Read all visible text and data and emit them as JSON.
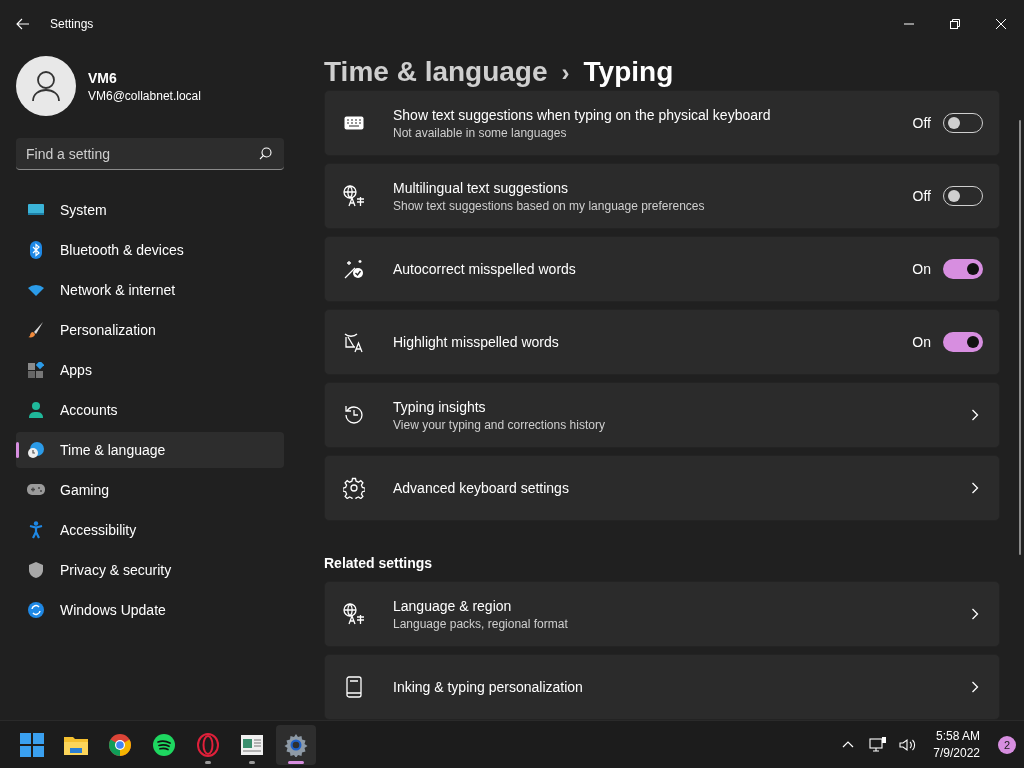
{
  "window": {
    "title": "Settings"
  },
  "user": {
    "name": "VM6",
    "email": "VM6@collabnet.local"
  },
  "search": {
    "placeholder": "Find a setting"
  },
  "sidebar": {
    "items": [
      {
        "label": "System",
        "selected": false
      },
      {
        "label": "Bluetooth & devices",
        "selected": false
      },
      {
        "label": "Network & internet",
        "selected": false
      },
      {
        "label": "Personalization",
        "selected": false
      },
      {
        "label": "Apps",
        "selected": false
      },
      {
        "label": "Accounts",
        "selected": false
      },
      {
        "label": "Time & language",
        "selected": true
      },
      {
        "label": "Gaming",
        "selected": false
      },
      {
        "label": "Accessibility",
        "selected": false
      },
      {
        "label": "Privacy & security",
        "selected": false
      },
      {
        "label": "Windows Update",
        "selected": false
      }
    ]
  },
  "breadcrumb": {
    "parent": "Time & language",
    "separator": "›",
    "current": "Typing"
  },
  "cards": [
    {
      "kind": "toggle",
      "title": "Show text suggestions when typing on the physical keyboard",
      "subtitle": "Not available in some languages",
      "state_label": "Off",
      "on": false
    },
    {
      "kind": "toggle",
      "title": "Multilingual text suggestions",
      "subtitle": "Show text suggestions based on my language preferences",
      "state_label": "Off",
      "on": false
    },
    {
      "kind": "toggle",
      "title": "Autocorrect misspelled words",
      "state_label": "On",
      "on": true
    },
    {
      "kind": "toggle",
      "title": "Highlight misspelled words",
      "state_label": "On",
      "on": true
    },
    {
      "kind": "link",
      "title": "Typing insights",
      "subtitle": "View your typing and corrections history"
    },
    {
      "kind": "link",
      "title": "Advanced keyboard settings"
    }
  ],
  "related": {
    "heading": "Related settings",
    "cards": [
      {
        "kind": "link",
        "title": "Language & region",
        "subtitle": "Language packs, regional format"
      },
      {
        "kind": "link",
        "title": "Inking & typing personalization"
      }
    ]
  },
  "taskbar": {
    "apps": [
      {
        "running": false,
        "active": false
      },
      {
        "running": false,
        "active": false
      },
      {
        "running": false,
        "active": false
      },
      {
        "running": false,
        "active": false
      },
      {
        "running": true,
        "active": false
      },
      {
        "running": true,
        "active": false
      },
      {
        "running": true,
        "active": true
      }
    ],
    "time": "5:58 AM",
    "date": "7/9/2022",
    "notification_count": "2"
  }
}
